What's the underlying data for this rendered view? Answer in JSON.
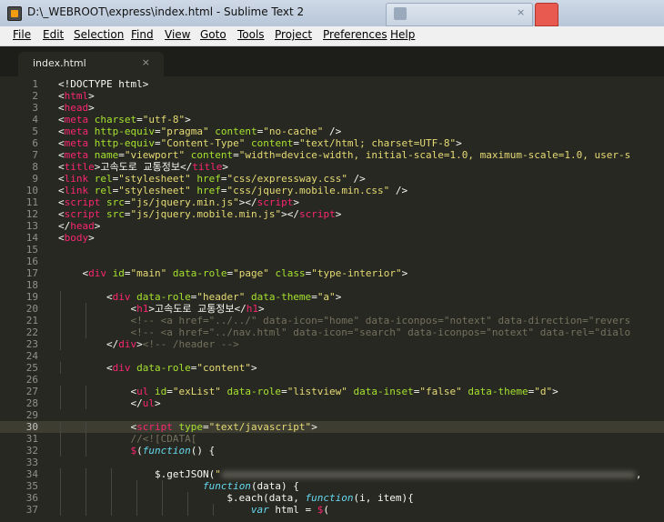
{
  "window": {
    "title": "D:\\_WEBROOT\\express\\index.html - Sublime Text 2"
  },
  "menu": [
    {
      "label": "File"
    },
    {
      "label": "Edit"
    },
    {
      "label": "Selection"
    },
    {
      "label": "Find"
    },
    {
      "label": "View"
    },
    {
      "label": "Goto"
    },
    {
      "label": "Tools"
    },
    {
      "label": "Project"
    },
    {
      "label": "Preferences"
    },
    {
      "label": "Help"
    }
  ],
  "tabs": [
    {
      "label": "index.html",
      "close": "×",
      "active": true
    }
  ],
  "icons": {
    "app": "sublime-text-icon",
    "tab_close": "close-icon"
  },
  "colors": {
    "editor_bg": "#272822",
    "tag": "#f92672",
    "attribute": "#a6e22e",
    "string": "#e6db74",
    "comment": "#75715e",
    "text": "#f8f8f2",
    "keyword": "#66d9ef",
    "active_line": "#3e3d32"
  },
  "editor": {
    "active_line": 30,
    "lines": [
      {
        "n": "1",
        "tokens": [
          [
            "txt",
            "<!DOCTYPE html>"
          ]
        ]
      },
      {
        "n": "2",
        "tokens": [
          [
            "txt",
            "<"
          ],
          [
            "tag",
            "html"
          ],
          [
            "txt",
            ">"
          ]
        ]
      },
      {
        "n": "3",
        "tokens": [
          [
            "txt",
            "<"
          ],
          [
            "tag",
            "head"
          ],
          [
            "txt",
            ">"
          ]
        ]
      },
      {
        "n": "4",
        "tokens": [
          [
            "txt",
            "<"
          ],
          [
            "tag",
            "meta"
          ],
          [
            "txt",
            " "
          ],
          [
            "attr",
            "charset"
          ],
          [
            "txt",
            "="
          ],
          [
            "str",
            "\"utf-8\""
          ],
          [
            "txt",
            ">"
          ]
        ]
      },
      {
        "n": "5",
        "tokens": [
          [
            "txt",
            "<"
          ],
          [
            "tag",
            "meta"
          ],
          [
            "txt",
            " "
          ],
          [
            "attr",
            "http-equiv"
          ],
          [
            "txt",
            "="
          ],
          [
            "str",
            "\"pragma\""
          ],
          [
            "txt",
            " "
          ],
          [
            "attr",
            "content"
          ],
          [
            "txt",
            "="
          ],
          [
            "str",
            "\"no-cache\""
          ],
          [
            "txt",
            " />"
          ]
        ]
      },
      {
        "n": "6",
        "tokens": [
          [
            "txt",
            "<"
          ],
          [
            "tag",
            "meta"
          ],
          [
            "txt",
            " "
          ],
          [
            "attr",
            "http-equiv"
          ],
          [
            "txt",
            "="
          ],
          [
            "str",
            "\"Content-Type\""
          ],
          [
            "txt",
            " "
          ],
          [
            "attr",
            "content"
          ],
          [
            "txt",
            "="
          ],
          [
            "str",
            "\"text/html; charset=UTF-8\""
          ],
          [
            "txt",
            ">"
          ]
        ]
      },
      {
        "n": "7",
        "tokens": [
          [
            "txt",
            "<"
          ],
          [
            "tag",
            "meta"
          ],
          [
            "txt",
            " "
          ],
          [
            "attr",
            "name"
          ],
          [
            "txt",
            "="
          ],
          [
            "str",
            "\"viewport\""
          ],
          [
            "txt",
            " "
          ],
          [
            "attr",
            "content"
          ],
          [
            "txt",
            "="
          ],
          [
            "str",
            "\"width=device-width, initial-scale=1.0, maximum-scale=1.0, user-s"
          ]
        ]
      },
      {
        "n": "8",
        "tokens": [
          [
            "txt",
            "<"
          ],
          [
            "tag",
            "title"
          ],
          [
            "txt",
            ">고속도로 교통정보</"
          ],
          [
            "tag",
            "title"
          ],
          [
            "txt",
            ">"
          ]
        ]
      },
      {
        "n": "9",
        "tokens": [
          [
            "txt",
            "<"
          ],
          [
            "tag",
            "link"
          ],
          [
            "txt",
            " "
          ],
          [
            "attr",
            "rel"
          ],
          [
            "txt",
            "="
          ],
          [
            "str",
            "\"stylesheet\""
          ],
          [
            "txt",
            " "
          ],
          [
            "attr",
            "href"
          ],
          [
            "txt",
            "="
          ],
          [
            "str",
            "\"css/expressway.css\""
          ],
          [
            "txt",
            " />"
          ]
        ]
      },
      {
        "n": "10",
        "tokens": [
          [
            "txt",
            "<"
          ],
          [
            "tag",
            "link"
          ],
          [
            "txt",
            " "
          ],
          [
            "attr",
            "rel"
          ],
          [
            "txt",
            "="
          ],
          [
            "str",
            "\"stylesheet\""
          ],
          [
            "txt",
            " "
          ],
          [
            "attr",
            "href"
          ],
          [
            "txt",
            "="
          ],
          [
            "str",
            "\"css/jquery.mobile.min.css\""
          ],
          [
            "txt",
            " />"
          ]
        ]
      },
      {
        "n": "11",
        "tokens": [
          [
            "txt",
            "<"
          ],
          [
            "tag",
            "script"
          ],
          [
            "txt",
            " "
          ],
          [
            "attr",
            "src"
          ],
          [
            "txt",
            "="
          ],
          [
            "str",
            "\"js/jquery.min.js\""
          ],
          [
            "txt",
            "></"
          ],
          [
            "tag",
            "script"
          ],
          [
            "txt",
            ">"
          ]
        ]
      },
      {
        "n": "12",
        "tokens": [
          [
            "txt",
            "<"
          ],
          [
            "tag",
            "script"
          ],
          [
            "txt",
            " "
          ],
          [
            "attr",
            "src"
          ],
          [
            "txt",
            "="
          ],
          [
            "str",
            "\"js/jquery.mobile.min.js\""
          ],
          [
            "txt",
            "></"
          ],
          [
            "tag",
            "script"
          ],
          [
            "txt",
            ">"
          ]
        ]
      },
      {
        "n": "13",
        "tokens": [
          [
            "txt",
            "</"
          ],
          [
            "tag",
            "head"
          ],
          [
            "txt",
            ">"
          ]
        ]
      },
      {
        "n": "14",
        "tokens": [
          [
            "txt",
            "<"
          ],
          [
            "tag",
            "body"
          ],
          [
            "txt",
            ">"
          ]
        ]
      },
      {
        "n": "15",
        "tokens": []
      },
      {
        "n": "16",
        "tokens": []
      },
      {
        "n": "17",
        "tokens": [
          [
            "txt",
            "    <"
          ],
          [
            "tag",
            "div"
          ],
          [
            "txt",
            " "
          ],
          [
            "attr",
            "id"
          ],
          [
            "txt",
            "="
          ],
          [
            "str",
            "\"main\""
          ],
          [
            "txt",
            " "
          ],
          [
            "attr",
            "data-role"
          ],
          [
            "txt",
            "="
          ],
          [
            "str",
            "\"page\""
          ],
          [
            "txt",
            " "
          ],
          [
            "attr",
            "class"
          ],
          [
            "txt",
            "="
          ],
          [
            "str",
            "\"type-interior\""
          ],
          [
            "txt",
            ">"
          ]
        ]
      },
      {
        "n": "18",
        "tokens": []
      },
      {
        "n": "19",
        "tokens": [
          [
            "txt",
            "        <"
          ],
          [
            "tag",
            "div"
          ],
          [
            "txt",
            " "
          ],
          [
            "attr",
            "data-role"
          ],
          [
            "txt",
            "="
          ],
          [
            "str",
            "\"header\""
          ],
          [
            "txt",
            " "
          ],
          [
            "attr",
            "data-theme"
          ],
          [
            "txt",
            "="
          ],
          [
            "str",
            "\"a\""
          ],
          [
            "txt",
            ">"
          ]
        ]
      },
      {
        "n": "20",
        "tokens": [
          [
            "txt",
            "            <"
          ],
          [
            "tag",
            "h1"
          ],
          [
            "txt",
            ">고속도로 교통정보</"
          ],
          [
            "tag",
            "h1"
          ],
          [
            "txt",
            ">"
          ]
        ]
      },
      {
        "n": "21",
        "tokens": [
          [
            "cm",
            "            <!-- <a href=\"../../\" data-icon=\"home\" data-iconpos=\"notext\" data-direction=\"revers"
          ]
        ]
      },
      {
        "n": "22",
        "tokens": [
          [
            "cm",
            "            <!-- <a href=\"../nav.html\" data-icon=\"search\" data-iconpos=\"notext\" data-rel=\"dialo"
          ]
        ]
      },
      {
        "n": "23",
        "tokens": [
          [
            "txt",
            "        </"
          ],
          [
            "tag",
            "div"
          ],
          [
            "txt",
            ">"
          ],
          [
            "cm",
            "<!-- /header -->"
          ]
        ]
      },
      {
        "n": "24",
        "tokens": []
      },
      {
        "n": "25",
        "tokens": [
          [
            "txt",
            "        <"
          ],
          [
            "tag",
            "div"
          ],
          [
            "txt",
            " "
          ],
          [
            "attr",
            "data-role"
          ],
          [
            "txt",
            "="
          ],
          [
            "str",
            "\"content\""
          ],
          [
            "txt",
            ">"
          ]
        ]
      },
      {
        "n": "26",
        "tokens": []
      },
      {
        "n": "27",
        "tokens": [
          [
            "txt",
            "            <"
          ],
          [
            "tag",
            "ul"
          ],
          [
            "txt",
            " "
          ],
          [
            "attr",
            "id"
          ],
          [
            "txt",
            "="
          ],
          [
            "str",
            "\"exList\""
          ],
          [
            "txt",
            " "
          ],
          [
            "attr",
            "data-role"
          ],
          [
            "txt",
            "="
          ],
          [
            "str",
            "\"listview\""
          ],
          [
            "txt",
            " "
          ],
          [
            "attr",
            "data-inset"
          ],
          [
            "txt",
            "="
          ],
          [
            "str",
            "\"false\""
          ],
          [
            "txt",
            " "
          ],
          [
            "attr",
            "data-theme"
          ],
          [
            "txt",
            "="
          ],
          [
            "str",
            "\"d\""
          ],
          [
            "txt",
            ">"
          ]
        ]
      },
      {
        "n": "28",
        "tokens": [
          [
            "txt",
            "            </"
          ],
          [
            "tag",
            "ul"
          ],
          [
            "txt",
            ">"
          ]
        ]
      },
      {
        "n": "29",
        "tokens": []
      },
      {
        "n": "30",
        "tokens": [
          [
            "txt",
            "            <"
          ],
          [
            "tag",
            "script"
          ],
          [
            "txt",
            " "
          ],
          [
            "attr",
            "type"
          ],
          [
            "txt",
            "="
          ],
          [
            "str",
            "\"text/javascript\""
          ],
          [
            "txt",
            ">"
          ]
        ]
      },
      {
        "n": "31",
        "tokens": [
          [
            "cm",
            "            //<![CDATA["
          ]
        ]
      },
      {
        "n": "32",
        "tokens": [
          [
            "txt",
            "            "
          ],
          [
            "tag",
            "$"
          ],
          [
            "txt",
            "("
          ],
          [
            "kw",
            "function"
          ],
          [
            "txt",
            "() {"
          ]
        ]
      },
      {
        "n": "33",
        "tokens": []
      },
      {
        "n": "34",
        "tokens": [
          [
            "txt",
            "                $.getJSON("
          ],
          [
            "str",
            "\""
          ],
          [
            "blur",
            "60"
          ],
          [
            "txt",
            ","
          ]
        ]
      },
      {
        "n": "35",
        "tokens": [
          [
            "txt",
            "                        "
          ],
          [
            "kw",
            "function"
          ],
          [
            "txt",
            "(data) {"
          ]
        ]
      },
      {
        "n": "36",
        "tokens": [
          [
            "txt",
            "                            $.each(data, "
          ],
          [
            "kw",
            "function"
          ],
          [
            "txt",
            "(i, item){"
          ]
        ]
      },
      {
        "n": "37",
        "tokens": [
          [
            "txt",
            "                                "
          ],
          [
            "kw",
            "var"
          ],
          [
            "txt",
            " html = "
          ],
          [
            "tag",
            "$"
          ],
          [
            "txt",
            "("
          ]
        ]
      }
    ]
  }
}
